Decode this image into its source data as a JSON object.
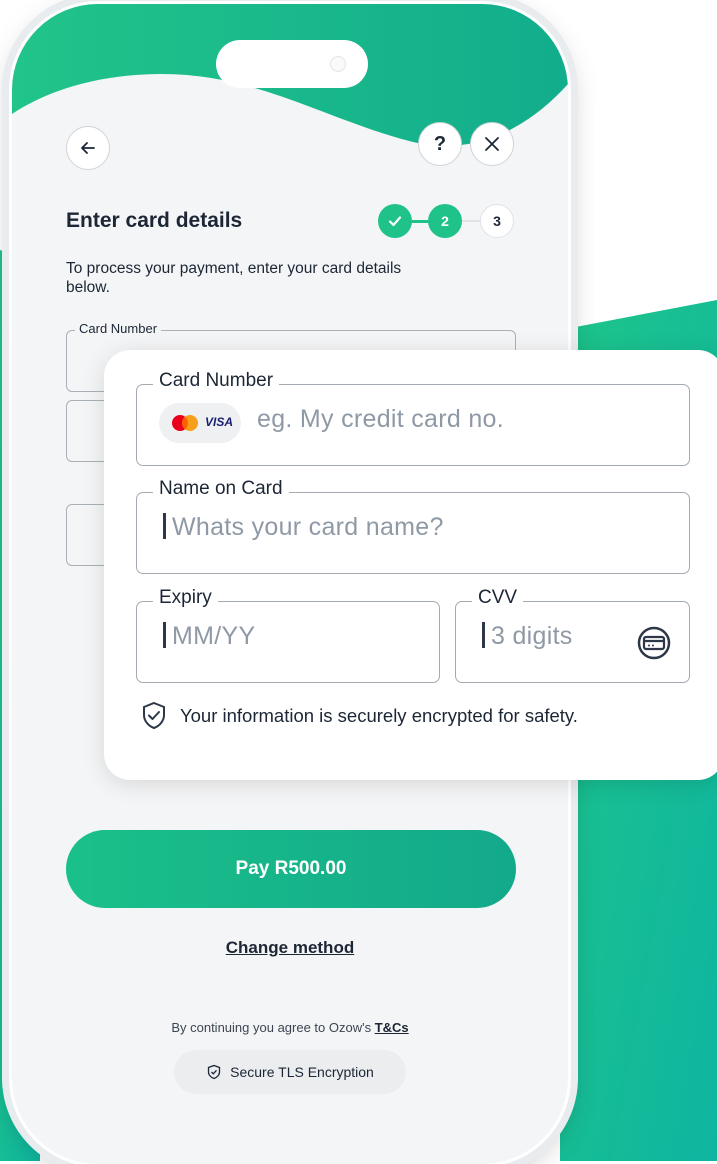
{
  "colors": {
    "accent": "#1fc38a",
    "accent_dark": "#13a98b",
    "text": "#1c2635",
    "placeholder": "#8f99a6"
  },
  "header": {
    "back_icon": "arrow-left-icon",
    "help_label": "?",
    "close_icon": "close-icon"
  },
  "page": {
    "title": "Enter card details",
    "description": "To process your payment, enter your card details below."
  },
  "stepper": {
    "steps": [
      {
        "label": "✓",
        "state": "done"
      },
      {
        "label": "2",
        "state": "active"
      },
      {
        "label": "3",
        "state": "pending"
      }
    ]
  },
  "background_form": {
    "card_number_label": "Card Number"
  },
  "card_form": {
    "card_number": {
      "label": "Card Number",
      "placeholder": "eg. My credit card no.",
      "brand_badge": "VISA"
    },
    "name": {
      "label": "Name on Card",
      "placeholder": "Whats your card name?"
    },
    "expiry": {
      "label": "Expiry",
      "placeholder": "MM/YY"
    },
    "cvv": {
      "label": "CVV",
      "placeholder": "3 digits",
      "icon": "card-icon"
    },
    "secure_note": "Your information is securely encrypted for safety."
  },
  "actions": {
    "pay_label": "Pay R500.00",
    "change_method": "Change method"
  },
  "footer": {
    "terms_text": "By continuing you agree to Ozow's ",
    "terms_link": "T&Cs",
    "tls_badge": "Secure TLS Encryption"
  }
}
